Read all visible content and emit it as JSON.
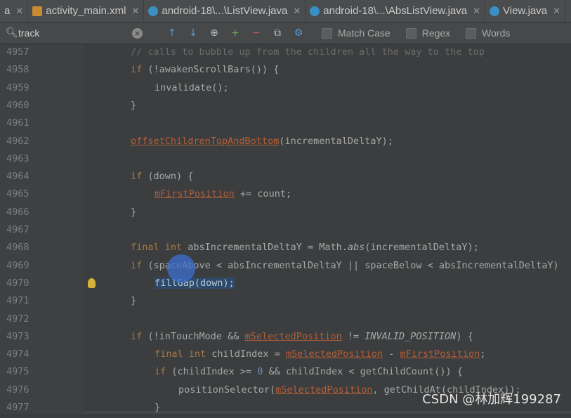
{
  "tabs": [
    {
      "label": "a",
      "icon": "xml-file-icon"
    },
    {
      "label": "activity_main.xml",
      "icon": "xml-file-icon"
    },
    {
      "label": "android-18\\...\\ListView.java",
      "icon": "java-class-icon"
    },
    {
      "label": "android-18\\...\\AbsListView.java",
      "icon": "java-class-icon"
    },
    {
      "label": "View.java",
      "icon": "java-class-icon"
    }
  ],
  "find": {
    "query": "track",
    "options": [
      {
        "label": "Match Case"
      },
      {
        "label": "Regex"
      },
      {
        "label": "Words"
      }
    ]
  },
  "lines": [
    {
      "n": "4957",
      "indent": 0,
      "segs": [
        {
          "t": "// calls to bubble up from the children all the way to the top",
          "c": "cmt"
        }
      ]
    },
    {
      "n": "4958",
      "indent": 0,
      "segs": [
        {
          "t": "if",
          "c": "kw"
        },
        {
          "t": " (!awakenScrollBars()) {"
        }
      ]
    },
    {
      "n": "4959",
      "indent": 1,
      "segs": [
        {
          "t": "invalidate();"
        }
      ]
    },
    {
      "n": "4960",
      "indent": 0,
      "segs": [
        {
          "t": "}"
        }
      ]
    },
    {
      "n": "4961",
      "indent": 0,
      "segs": []
    },
    {
      "n": "4962",
      "indent": 0,
      "segs": [
        {
          "t": "offsetChildrenTopAndBottom",
          "c": "fld"
        },
        {
          "t": "(incrementalDeltaY);"
        }
      ]
    },
    {
      "n": "4963",
      "indent": 0,
      "segs": []
    },
    {
      "n": "4964",
      "indent": 0,
      "segs": [
        {
          "t": "if",
          "c": "kw"
        },
        {
          "t": " (down) {"
        }
      ]
    },
    {
      "n": "4965",
      "indent": 1,
      "segs": [
        {
          "t": "mFirstPosition",
          "c": "fld"
        },
        {
          "t": " += count;"
        }
      ]
    },
    {
      "n": "4966",
      "indent": 0,
      "segs": [
        {
          "t": "}"
        }
      ]
    },
    {
      "n": "4967",
      "indent": 0,
      "segs": []
    },
    {
      "n": "4968",
      "indent": 0,
      "segs": [
        {
          "t": "final int",
          "c": "kw"
        },
        {
          "t": " absIncrementalDeltaY = Math."
        },
        {
          "t": "abs",
          "c": "ital"
        },
        {
          "t": "(incrementalDeltaY);"
        }
      ]
    },
    {
      "n": "4969",
      "indent": 0,
      "segs": [
        {
          "t": "if",
          "c": "kw"
        },
        {
          "t": " (spaceAbove < absIncrementalDeltaY || spaceBelow < absIncrementalDeltaY)"
        }
      ]
    },
    {
      "n": "4970",
      "indent": 1,
      "bulb": true,
      "segs": [
        {
          "t": "fillGap(down);",
          "c": "sel"
        }
      ]
    },
    {
      "n": "4971",
      "indent": 0,
      "segs": [
        {
          "t": "}"
        }
      ]
    },
    {
      "n": "4972",
      "indent": 0,
      "segs": []
    },
    {
      "n": "4973",
      "indent": 0,
      "segs": [
        {
          "t": "if",
          "c": "kw"
        },
        {
          "t": " (!inTouchMode && "
        },
        {
          "t": "mSelectedPosition",
          "c": "fld"
        },
        {
          "t": " != "
        },
        {
          "t": "INVALID_POSITION",
          "c": "ital"
        },
        {
          "t": ") {"
        }
      ]
    },
    {
      "n": "4974",
      "indent": 1,
      "segs": [
        {
          "t": "final int",
          "c": "kw"
        },
        {
          "t": " childIndex = "
        },
        {
          "t": "mSelectedPosition",
          "c": "fld"
        },
        {
          "t": " - "
        },
        {
          "t": "mFirstPosition",
          "c": "fld"
        },
        {
          "t": ";"
        }
      ]
    },
    {
      "n": "4975",
      "indent": 1,
      "segs": [
        {
          "t": "if",
          "c": "kw"
        },
        {
          "t": " (childIndex >= "
        },
        {
          "t": "0",
          "c": "num"
        },
        {
          "t": " && childIndex < getChildCount()) {"
        }
      ]
    },
    {
      "n": "4976",
      "indent": 2,
      "segs": [
        {
          "t": "positionSelector("
        },
        {
          "t": "mSelectedPosition",
          "c": "fld"
        },
        {
          "t": ", getChildAt(childIndex));"
        }
      ]
    },
    {
      "n": "4977",
      "indent": 1,
      "segs": [
        {
          "t": "}"
        }
      ]
    }
  ],
  "watermark": "CSDN @林加辉199287",
  "colors": {
    "background": "#3b3d3e",
    "keyword": "#a57a45",
    "field": "#b45f3a",
    "selection": "#2d4a6a"
  }
}
